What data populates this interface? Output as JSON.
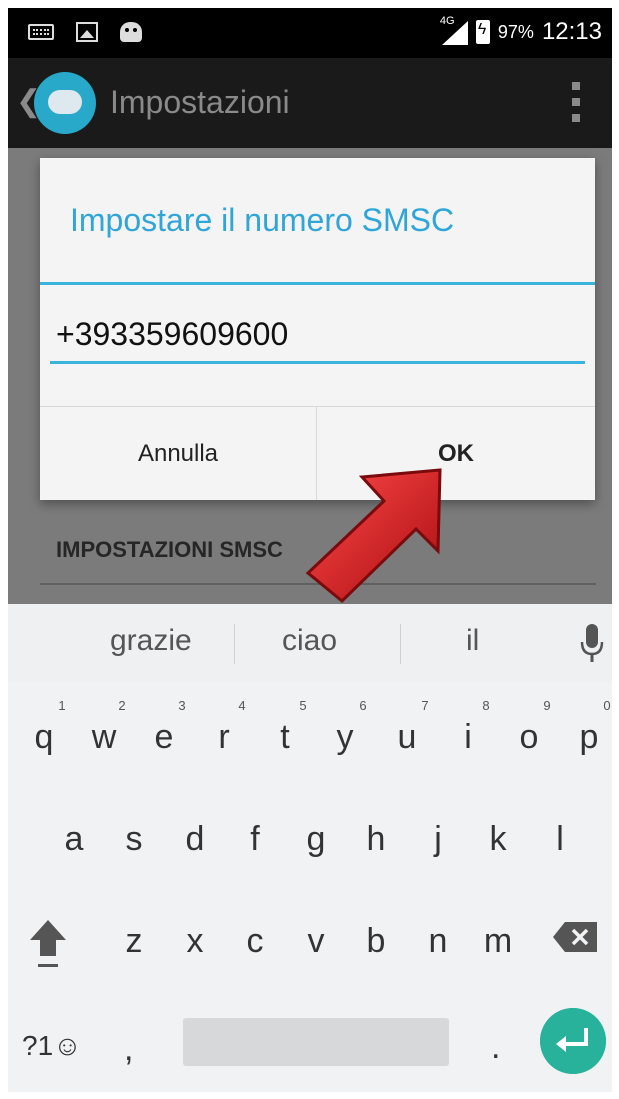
{
  "status_bar": {
    "network": "4G",
    "battery": "97%",
    "time": "12:13"
  },
  "action_bar": {
    "title": "Impostazioni"
  },
  "background": {
    "section_title": "IMPOSTAZIONI SMSC"
  },
  "dialog": {
    "title": "Impostare il numero SMSC",
    "input_value": "+393359609600",
    "cancel_label": "Annulla",
    "ok_label": "OK"
  },
  "keyboard": {
    "suggestions": [
      "grazie",
      "ciao",
      "il"
    ],
    "row1": [
      "q",
      "w",
      "e",
      "r",
      "t",
      "y",
      "u",
      "i",
      "o",
      "p"
    ],
    "row1_hints": [
      "1",
      "2",
      "3",
      "4",
      "5",
      "6",
      "7",
      "8",
      "9",
      "0"
    ],
    "row2": [
      "a",
      "s",
      "d",
      "f",
      "g",
      "h",
      "j",
      "k",
      "l"
    ],
    "row3": [
      "z",
      "x",
      "c",
      "v",
      "b",
      "n",
      "m"
    ],
    "symbols_label": "?1☺",
    "comma": ",",
    "period": "."
  },
  "colors": {
    "accent": "#2fa5d8",
    "enter": "#28b29b",
    "arrow": "#e0141b"
  }
}
